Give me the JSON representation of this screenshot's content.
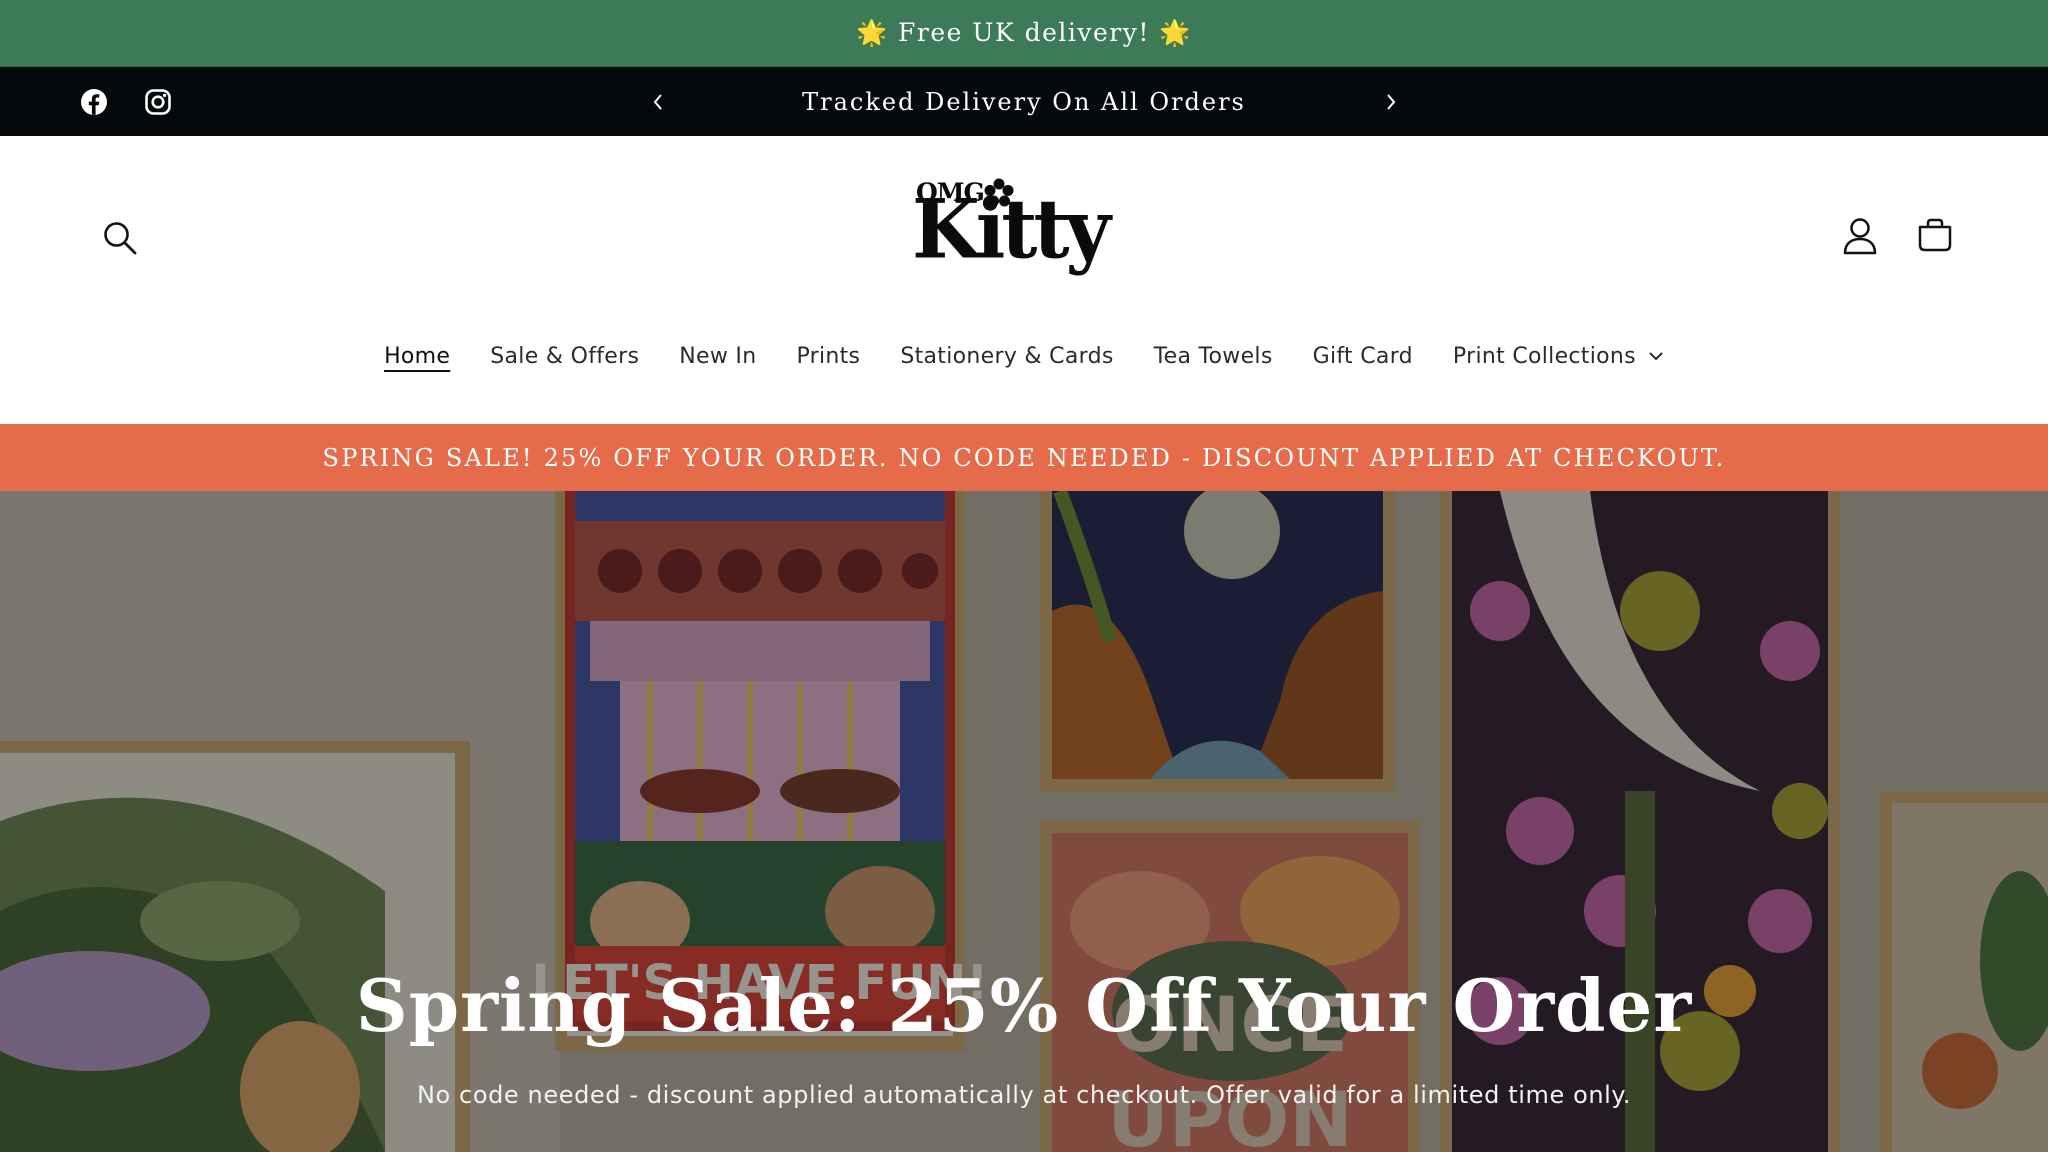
{
  "announcement": {
    "text": "🌟 Free UK delivery! 🌟"
  },
  "utility_bar": {
    "social": [
      "facebook-icon",
      "instagram-icon"
    ],
    "message": "Tracked Delivery On All Orders"
  },
  "header": {
    "logo": {
      "top_text": "OMG",
      "main_text": "Kitty"
    },
    "icons": [
      "search-icon",
      "account-icon",
      "cart-icon"
    ]
  },
  "nav": {
    "items": [
      {
        "label": "Home",
        "active": true
      },
      {
        "label": "Sale & Offers"
      },
      {
        "label": "New In"
      },
      {
        "label": "Prints"
      },
      {
        "label": "Stationery & Cards"
      },
      {
        "label": "Tea Towels"
      },
      {
        "label": "Gift Card"
      },
      {
        "label": "Print Collections",
        "has_dropdown": true
      }
    ]
  },
  "sale_banner": {
    "text": "SPRING SALE! 25% OFF YOUR ORDER. NO CODE NEEDED - DISCOUNT APPLIED AT CHECKOUT."
  },
  "hero": {
    "title": "Spring Sale: 25% Off Your Order",
    "subtitle": "No code needed - discount applied automatically at checkout. Offer valid for a limited time only.",
    "poster_text": [
      "LET'S HAVE FUN!",
      "ONCE",
      "UPON"
    ]
  },
  "colors": {
    "announcement_bg": "#3c7a58",
    "utility_bg": "#05090c",
    "sale_bg": "#e66b4b",
    "text_dark": "#121212"
  }
}
